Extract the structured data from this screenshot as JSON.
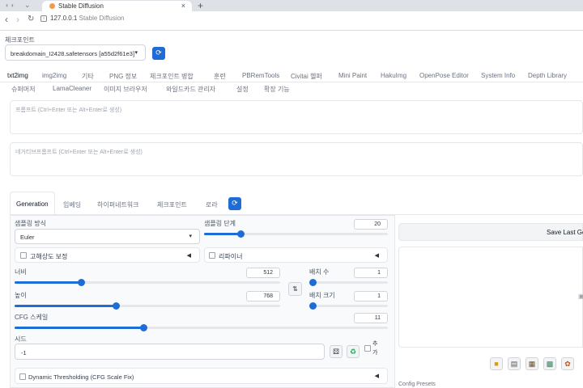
{
  "browser": {
    "tab_title": "Stable Diffusion",
    "tab_close": "×",
    "new_tab": "+",
    "url_host": "127.0.0.1",
    "url_title": "Stable Diffusion",
    "back": "‹",
    "forward": "›",
    "reload": "↻"
  },
  "checkpoint": {
    "label": "체크포인트",
    "value": "breakdomain_I2428.safetensors [a55d2f61e3]",
    "arrow": "▾",
    "refresh_icon": "refresh-icon"
  },
  "main_tabs": {
    "row1": [
      "txt2img",
      "img2img",
      "기타",
      "PNG 정보",
      "체크포인트 병합",
      "훈련",
      "PBRemTools",
      "Civitai 헬퍼",
      "Mini Paint",
      "HakuImg",
      "OpenPose Editor",
      "System Info",
      "Depth Library"
    ],
    "row2": [
      "슈퍼머저",
      "LamaCleaner",
      "이미지 브라우저",
      "와일드카드 관리자",
      "설정",
      "확장 기능"
    ],
    "active": "txt2img"
  },
  "prompt": {
    "placeholder": "프롬프트 (Ctrl+Enter 또는 Alt+Enter로 생성)"
  },
  "negative_prompt": {
    "placeholder": "네거티브프롬프트 (Ctrl+Enter 또는 Alt+Enter로 생성)"
  },
  "sub_tabs": {
    "items": [
      "Generation",
      "임베딩",
      "하이퍼네트워크",
      "체크포인트",
      "로라"
    ],
    "active": "Generation",
    "refresh_icon": "refresh-icon"
  },
  "sampler": {
    "label": "샘플링 방식",
    "value": "Euler",
    "arrow": "▾"
  },
  "steps": {
    "label": "샘플링 단계",
    "value": "20",
    "fraction": 0.2
  },
  "hires": {
    "label": "고해상도 보정",
    "tri": "◀"
  },
  "refiner": {
    "label": "리파이너",
    "tri": "◀"
  },
  "width": {
    "label": "너비",
    "value": "512",
    "fraction": 0.25
  },
  "height": {
    "label": "높이",
    "value": "768",
    "fraction": 0.38
  },
  "swap_icon": "⇅",
  "batch_count": {
    "label": "배치 수",
    "value": "1",
    "fraction": 0.0
  },
  "batch_size": {
    "label": "배치 크기",
    "value": "1",
    "fraction": 0.0
  },
  "cfg": {
    "label": "CFG 스케일",
    "value": "11",
    "fraction": 0.345
  },
  "seed": {
    "label": "시드",
    "value": "-1",
    "extra_label": "추가",
    "dice_icon": "dice-icon",
    "recycle_icon": "recycle-icon"
  },
  "dynamic_thresholding": {
    "label": "Dynamic Thresholding (CFG Scale Fix)",
    "tri": "◀"
  },
  "output": {
    "save_last": "Save Last Ge",
    "config_presets": "Config Presets",
    "tool_icons": [
      "folder-icon",
      "save-icon",
      "zip-icon",
      "image-icon",
      "palette-icon"
    ]
  },
  "colors": {
    "accent": "#1e6cd6",
    "panel": "#f9fafb",
    "border": "#e5e7eb"
  }
}
